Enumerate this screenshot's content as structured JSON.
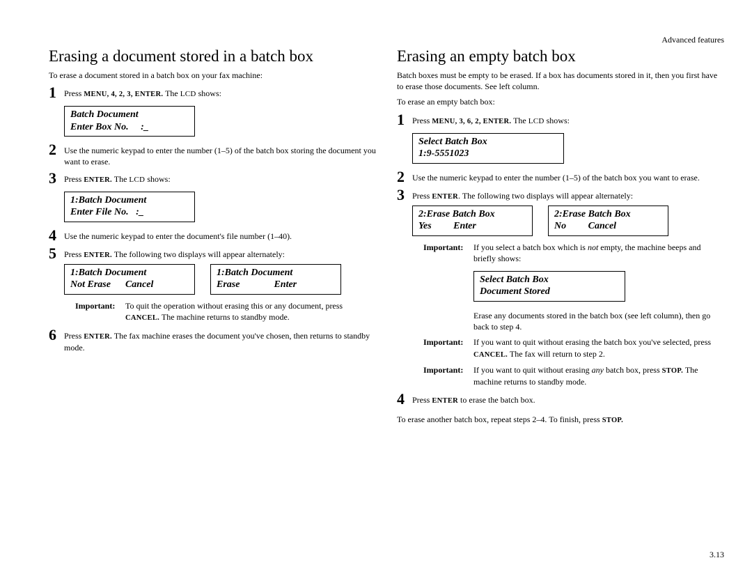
{
  "header": {
    "right": "Advanced features"
  },
  "page_number": "3.13",
  "left": {
    "title": "Erasing a document stored in a batch box",
    "intro": "To erase a document stored in a batch box on your fax machine:",
    "step1_a": "Press ",
    "step1_keys": "MENU, 4, 2, 3, ENTER.",
    "step1_b": " The ",
    "step1_lcd_word": "LCD",
    "step1_c": " shows:",
    "lcd1": "Batch Document\nEnter Box No.     :_",
    "step2": "Use the numeric keypad to enter the number (1–5) of the batch box storing the document you want to erase.",
    "step3_a": "Press ",
    "step3_key": "ENTER.",
    "step3_b": " The ",
    "step3_lcd_word": "LCD",
    "step3_c": " shows:",
    "lcd2": "1:Batch Document\nEnter File No.   :_",
    "step4": "Use the numeric keypad to enter the document's file number (1–40).",
    "step5_a": "Press ",
    "step5_key": "ENTER.",
    "step5_b": " The following two displays will appear alternately:",
    "lcd3a": "1:Batch Document\nNot Erase      Cancel",
    "lcd3b": "1:Batch Document\nErase              Enter",
    "important_label": "Important:",
    "important_a": "To quit the operation without erasing this or any document, press ",
    "important_key": "CANCEL.",
    "important_b": " The machine returns to standby mode.",
    "step6_a": "Press ",
    "step6_key": "ENTER.",
    "step6_b": " The fax machine erases the document you've chosen, then returns to standby mode."
  },
  "right": {
    "title": "Erasing an empty batch box",
    "intro1": "Batch boxes must be empty to be erased. If a box has documents stored in it, then you first have to erase those documents. See left column.",
    "intro2": "To erase an empty batch box:",
    "step1_a": "Press ",
    "step1_keys": "MENU, 3, 6, 2, ENTER.",
    "step1_b": " The ",
    "step1_lcd_word": "LCD",
    "step1_c": " shows:",
    "lcd1": "Select Batch Box\n1:9-5551023",
    "step2": "Use the numeric keypad to enter the number (1–5) of the batch box you want to erase.",
    "step3_a": "Press ",
    "step3_key": "ENTER",
    "step3_b": ". The following two displays will appear alternately:",
    "lcd2a": "2:Erase Batch Box\nYes         Enter",
    "lcd2b": "2:Erase Batch Box\nNo         Cancel",
    "imp1_label": "Important:",
    "imp1_a": "If you select a batch box which is ",
    "imp1_em": "not",
    "imp1_b": " empty, the machine beeps and briefly shows:",
    "lcd3": "Select Batch Box\nDocument Stored",
    "note_a": "Erase any documents stored in the batch box (see left column), then go back to step 4.",
    "imp2_label": "Important:",
    "imp2_a": "If you want to quit without erasing the batch box you've selected, press ",
    "imp2_key": "CANCEL.",
    "imp2_b": " The fax will return to step 2.",
    "imp3_label": "Important:",
    "imp3_a": "If you want to quit without erasing ",
    "imp3_em": "any",
    "imp3_b": " batch box, press ",
    "imp3_key": "STOP.",
    "imp3_c": " The machine returns to standby mode.",
    "step4_a": "Press ",
    "step4_key": "ENTER",
    "step4_b": " to erase the batch box.",
    "closing_a": "To erase another batch box, repeat steps 2–4. To finish, press ",
    "closing_key": "STOP.",
    "closing_b": ""
  }
}
